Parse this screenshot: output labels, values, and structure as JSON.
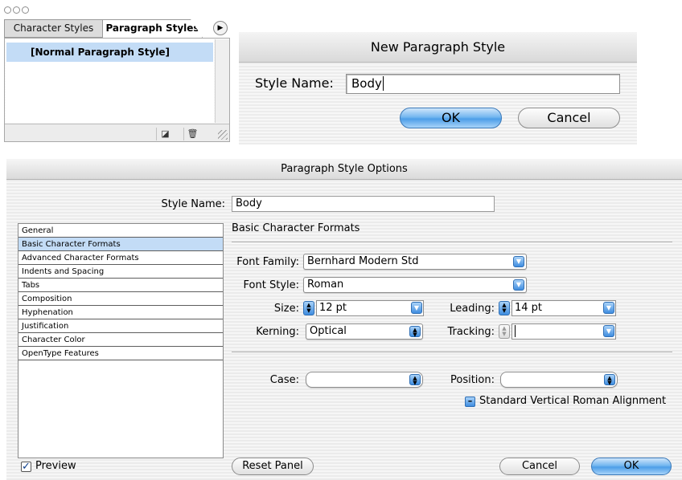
{
  "palette": {
    "tabs": [
      "Character Styles",
      "Paragraph Styles"
    ],
    "items": [
      "[Normal Paragraph Style]"
    ],
    "footer_icons": [
      "new-style-icon",
      "trash-icon"
    ]
  },
  "new_style_dialog": {
    "title": "New Paragraph Style",
    "style_name_label": "Style Name:",
    "style_name_value": "Body",
    "ok_label": "OK",
    "cancel_label": "Cancel"
  },
  "options_dialog": {
    "title": "Paragraph Style Options",
    "style_name_label": "Style Name:",
    "style_name_value": "Body",
    "categories": [
      "General",
      "Basic Character Formats",
      "Advanced Character Formats",
      "Indents and Spacing",
      "Tabs",
      "Composition",
      "Hyphenation",
      "Justification",
      "Character Color",
      "OpenType Features"
    ],
    "selected_category": "Basic Character Formats",
    "section_title": "Basic Character Formats",
    "fields": {
      "font_family": {
        "label": "Font Family:",
        "value": "Bernhard Modern Std"
      },
      "font_style": {
        "label": "Font Style:",
        "value": "Roman"
      },
      "size": {
        "label": "Size:",
        "value": "12 pt"
      },
      "leading": {
        "label": "Leading:",
        "value": "14 pt"
      },
      "kerning": {
        "label": "Kerning:",
        "value": "Optical"
      },
      "tracking": {
        "label": "Tracking:",
        "value": ""
      },
      "case": {
        "label": "Case:",
        "value": ""
      },
      "position": {
        "label": "Position:",
        "value": ""
      }
    },
    "svra_label": "Standard Vertical Roman Alignment",
    "preview_label": "Preview",
    "preview_checked": true,
    "reset_label": "Reset Panel",
    "cancel_label": "Cancel",
    "ok_label": "OK"
  },
  "colors": {
    "selection": "#c3dcf6",
    "aqua_blue": "#4d9ee8"
  }
}
